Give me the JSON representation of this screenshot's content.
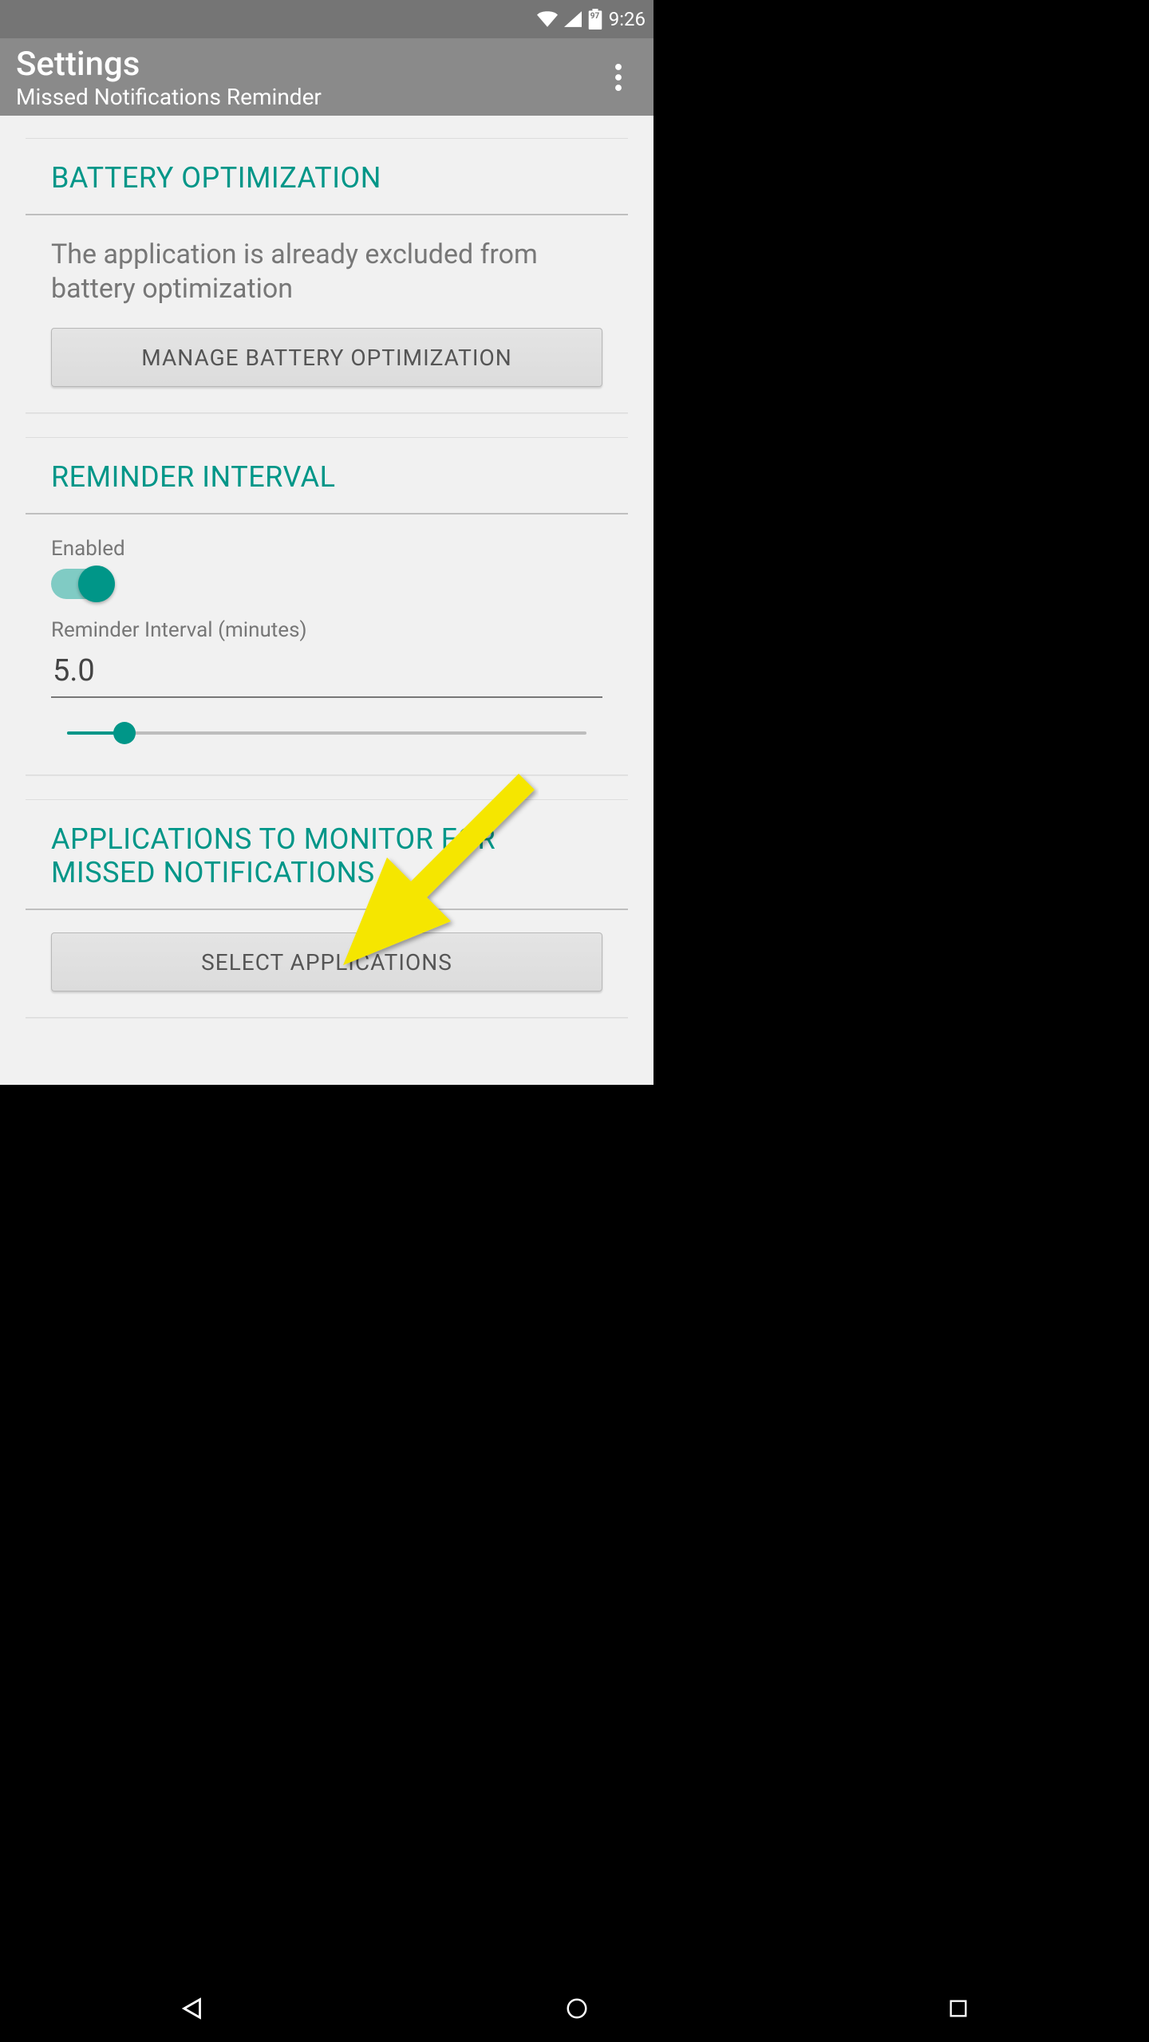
{
  "status": {
    "battery_pct": "97",
    "time": "9:26"
  },
  "appbar": {
    "title": "Settings",
    "subtitle": "Missed Notifications Reminder"
  },
  "battery_opt": {
    "header": "BATTERY OPTIMIZATION",
    "desc": "The application is already excluded from battery optimization",
    "manage_label": "MANAGE BATTERY OPTIMIZATION"
  },
  "interval": {
    "header": "REMINDER INTERVAL",
    "enabled_label": "Enabled",
    "enabled": true,
    "field_label": "Reminder Interval (minutes)",
    "value": "5.0",
    "slider_pct": 11
  },
  "apps": {
    "header": "APPLICATIONS TO MONITOR FOR MISSED NOTIFICATIONS",
    "select_label": "SELECT APPLICATIONS"
  },
  "colors": {
    "accent": "#009688",
    "arrow": "#f8e71c"
  }
}
